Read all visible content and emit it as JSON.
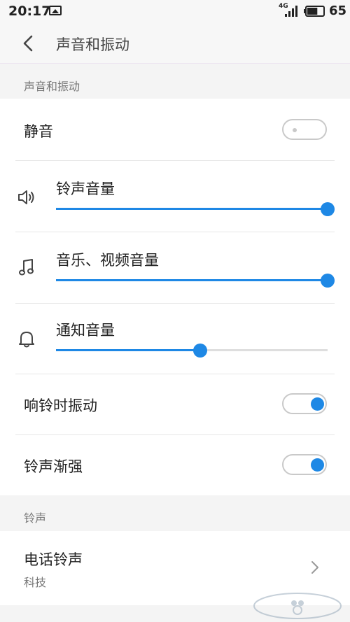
{
  "statusbar": {
    "time": "20:17",
    "network": "4G",
    "battery": "65",
    "battery_level": 0.65
  },
  "header": {
    "title": "声音和振动"
  },
  "sections": {
    "sound": {
      "label": "声音和振动"
    },
    "ringtone": {
      "label": "铃声"
    }
  },
  "mute": {
    "label": "静音",
    "on": false
  },
  "volumes": [
    {
      "label": "铃声音量",
      "icon": "speaker-icon",
      "level": 1.0
    },
    {
      "label": "音乐、视频音量",
      "icon": "music-note-icon",
      "level": 1.0
    },
    {
      "label": "通知音量",
      "icon": "bell-icon",
      "level": 0.53
    }
  ],
  "vibrate_on_ring": {
    "label": "响铃时振动",
    "on": true
  },
  "ring_crescendo": {
    "label": "铃声渐强",
    "on": true
  },
  "phone_ringtone": {
    "label": "电话铃声",
    "value": "科技"
  },
  "colors": {
    "accent": "#1e88e5",
    "background": "#f4f4f4"
  }
}
